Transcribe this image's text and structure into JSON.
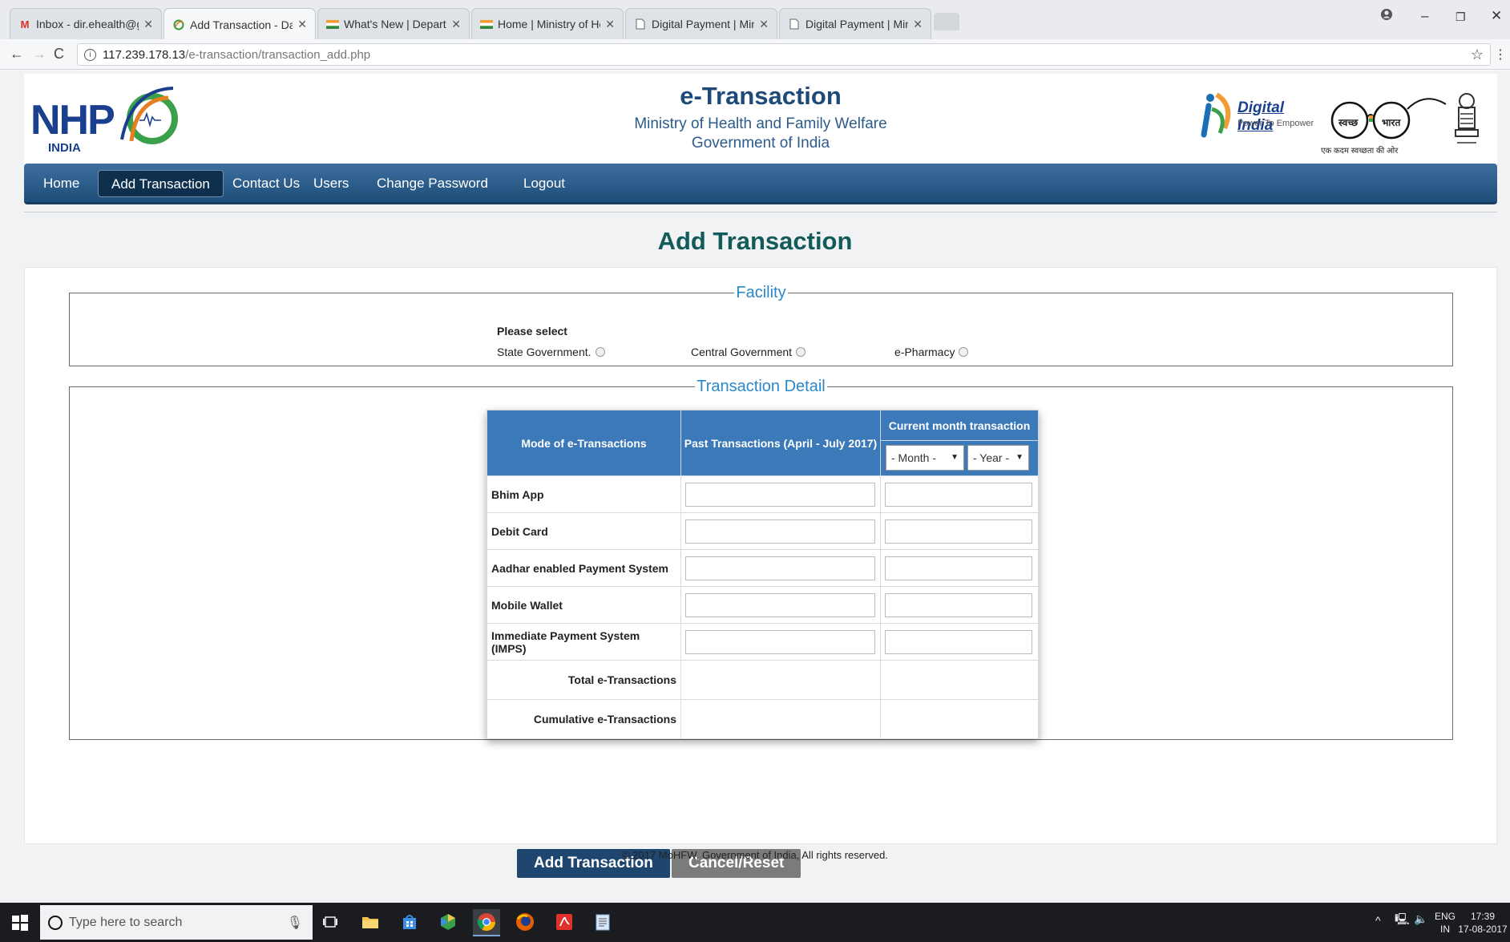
{
  "browser": {
    "tabs": [
      {
        "label": "Inbox - dir.ehealth@gm",
        "icon": "gmail-icon"
      },
      {
        "label": "Add Transaction - Dashb",
        "icon": "nhp-favicon"
      },
      {
        "label": "What's New | Departmen",
        "icon": "india-flag-icon"
      },
      {
        "label": "Home | Ministry of Healt",
        "icon": "india-flag-icon"
      },
      {
        "label": "Digital Payment | Ministr",
        "icon": "document-icon"
      },
      {
        "label": "Digital Payment | Ministr",
        "icon": "document-icon"
      }
    ],
    "active_tab": 1,
    "url_host": "117.239.178.13",
    "url_path": "/e-transaction/transaction_add.php"
  },
  "header": {
    "logo_text": "NHP",
    "logo_sub": "INDIA",
    "title": "e-Transaction",
    "subtitle": "Ministry of Health and Family Welfare",
    "subtitle2": "Government of India",
    "digital_india": "Digital India",
    "digital_india_tag": "Power To Empower",
    "swachh_left": "स्वच्छ",
    "swachh_right": "भारत",
    "swachh_caption": "एक कदम स्वच्छता की ओर"
  },
  "nav": {
    "items": [
      "Home",
      "Add Transaction",
      "Contact Us",
      "Users",
      "Change Password",
      "Logout"
    ],
    "active": "Add Transaction"
  },
  "page_title": "Add Transaction",
  "facility": {
    "legend": "Facility",
    "prompt": "Please select",
    "options": [
      "State Government.",
      "Central Government",
      "e-Pharmacy"
    ]
  },
  "transaction": {
    "legend": "Transaction Detail",
    "columns": {
      "mode": "Mode of e-Transactions",
      "past": "Past Transactions (April - July 2017)",
      "current": "Current month transaction"
    },
    "month_select": "- Month -",
    "year_select": "- Year -",
    "rows": [
      "Bhim App",
      "Debit Card",
      "Aadhar enabled Payment System",
      "Mobile Wallet",
      "Immediate Payment System (IMPS)"
    ],
    "total_label": "Total e-Transactions",
    "cumulative_label": "Cumulative e-Transactions"
  },
  "buttons": {
    "add": "Add Transaction",
    "cancel": "Cancel/Reset"
  },
  "footer": "© 2017 MoHFW, Government of India, All rights reserved.",
  "taskbar": {
    "search_placeholder": "Type here to search",
    "lang": "ENG",
    "region": "IN",
    "time": "17:39",
    "date": "17-08-2017"
  },
  "colors": {
    "nav_bg": "#1d4d78",
    "table_header": "#3c79b8",
    "legend": "#2b88c8",
    "page_title": "#135a5a",
    "add_button": "#1e466f",
    "cancel_button": "#7b7b7b"
  }
}
